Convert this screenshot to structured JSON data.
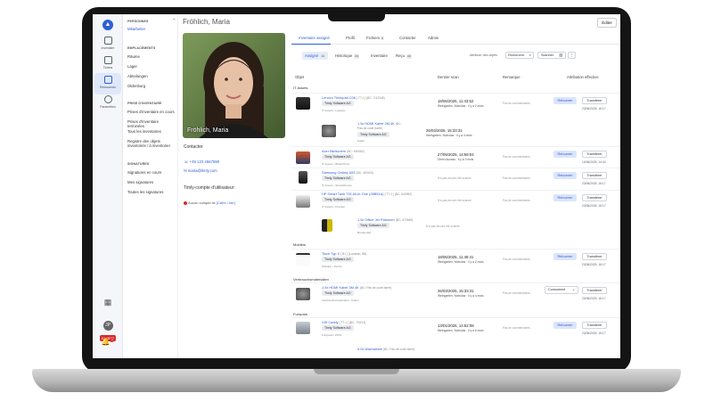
{
  "rail": {
    "items": [
      {
        "label": "Inventaire"
      },
      {
        "label": "Tickets"
      },
      {
        "label": "Ressources"
      },
      {
        "label": "Paramètres"
      }
    ],
    "avatar": "JP",
    "version": "61 9882"
  },
  "nav": {
    "sections": [
      {
        "title": "PERSONNES",
        "items": [
          "Mitarbeiter"
        ]
      },
      {
        "title": "EMPLACEMENTS",
        "items": [
          "Räume",
          "Lager",
          "Abteilungen",
          "Oldenburg"
        ]
      },
      {
        "title": "PRISE D'INVENTAIRE",
        "items": [
          "Prises d'inventaire en cours",
          "Prises d'inventaire terminées",
          "Tous les inventaires",
          "Registre des objets inventoriés / à inventorier"
        ]
      },
      {
        "title": "SIGNATURES",
        "items": [
          "Signatures en cours",
          "Mes signatures",
          "Toutes les signatures"
        ]
      }
    ]
  },
  "header": {
    "title": "Fröhlich, Maria",
    "edit_label": "Éditer"
  },
  "profile": {
    "name": "Fröhlich, Maria",
    "contact_heading": "Contacter",
    "phone": "+49 123 4567890",
    "email": "maria@timly.com",
    "account_heading": "Timly-compte d'utilisateur:",
    "account_status": "Aucun compte lié",
    "account_link": "[Créer / lier]"
  },
  "tabs": [
    {
      "label": "Inventaire assigné",
      "badge": ""
    },
    {
      "label": "Profil",
      "badge": ""
    },
    {
      "label": "Fichiers",
      "badge": "0"
    },
    {
      "label": "Contacter",
      "badge": ""
    },
    {
      "label": "Admin",
      "badge": ""
    }
  ],
  "subtabs": [
    {
      "label": "Assigné",
      "badge": "14"
    },
    {
      "label": "Historique",
      "badge": "24"
    },
    {
      "label": "Inventaire",
      "badge": ""
    },
    {
      "label": "Reçu",
      "badge": "44"
    }
  ],
  "toolbar": {
    "attribute_label": "Attribuer des objets",
    "search_placeholder": "Rechercher",
    "scan_label": "Scanner"
  },
  "columns": {
    "object": "Objet",
    "last_scan": "Dernier scan",
    "remark": "Remarque",
    "assignment": "Attribution effective"
  },
  "groups": [
    {
      "label": "IT Assets"
    },
    {
      "label": "Mobiliar"
    },
    {
      "label": "Verbrauchsmaterialien"
    },
    {
      "label": "Fuhrpark"
    }
  ],
  "rows": [
    {
      "name": "Lenovo Thinkpad C06",
      "tag": "[ T7.1 ] (BC: 7/12345)",
      "chip": "Timly Software AG",
      "cat": "IT Assets › Laptops",
      "date": "18/06/2025, 11:43:52",
      "by": "Weingarten, Nicholas · il y a 2 mois",
      "note": "Pas de commentaires",
      "ret": "Retourner",
      "tr": "Transférer",
      "adate": "23/06/2025, 16:17"
    },
    {
      "name": "1.5x HDMI Kabel 2M,4K",
      "tag": "(BC: Pas de code barre)",
      "chip": "Timly Software AG",
      "cat": "Kabel",
      "date": "26/03/2025, 15:33:31",
      "by": "Weingarten, Nicholas · il y a 4 mois",
      "note": "",
      "ret": "",
      "tr": "",
      "adate": ""
    },
    {
      "name": "Acer Bildschirm",
      "tag": "(BC: 490060)",
      "chip": "Timly Software AG",
      "cat": "IT Assets › Bildschirme",
      "date": "27/05/2025, 14:59:04",
      "by": "Direct Access · il y a 3 mois",
      "note": "Pas de commentaires",
      "ret": "Retourner",
      "tr": "Transférer",
      "adate": "10/06/2025, 14:40"
    },
    {
      "name": "Samsung Galaxy A53",
      "tag": "(BC: 490100)",
      "chip": "Timly Software AG",
      "cat": "IT Assets › Smartphones",
      "date": "",
      "by": "",
      "note": "N'a pas encore été scanné",
      "ret": "Retourner",
      "tr": "Transférer",
      "adate": "23/06/2025, 16:17"
    },
    {
      "name": "HP Smart Tank 725 All-In-One (28B51A)",
      "tag": "[ T7.1 ] (BC: 540952)",
      "chip": "Timly Software AG",
      "cat": "IT Assets › Drucker",
      "date": "",
      "by": "",
      "note": "N'a pas encore été scanné",
      "ret": "Retourner",
      "tr": "Transférer",
      "adate": "23/06/2025, 16:17"
    },
    {
      "name": "1.5x Office Jet Patronen",
      "tag": "(BC: 470680)",
      "chip": "Timly Software AG",
      "cat": "Bürobedarf",
      "date": "",
      "by": "",
      "note": "N'a pas encore été scanné",
      "ret": "",
      "tr": "",
      "adate": ""
    },
    {
      "name": "Tisch Typ X",
      "tag": "[ B1 ] (Location: B5)",
      "chip": "Timly Software AG",
      "cat": "Mobiliar › Tische",
      "date": "18/06/2025, 11:49:41",
      "by": "Weingarten, Nicholas · il y a 2 mois",
      "note": "Pas de commentaires",
      "ret": "Retourner",
      "tr": "Transférer",
      "adate": "23/06/2025, 16:17"
    },
    {
      "name": "1.5x HDMI Kabel 3M,4K",
      "tag": "(BC: Pas de code barre)",
      "chip": "Timly Software AG",
      "cat": "Verbrauchsmaterialien › Kabel",
      "date": "26/03/2025, 15:33:31",
      "by": "Weingarten, Nicholas · il y a 4 mois",
      "note": "Pas de commentaires",
      "ret": "",
      "tr": "Transférer",
      "adate": "23/06/2025, 16:17",
      "cons": "Consommé"
    },
    {
      "name": "VW Caddy",
      "tag": "[ T7.1 ] (BC: 7/N/12)",
      "chip": "Timly Software AG",
      "cat": "Fuhrpark › PKW",
      "date": "13/01/2025, 14:52:08",
      "by": "Weingarten, Nicholas · il y a 6 mois",
      "note": "Pas de commentaires",
      "ret": "Retourner",
      "tr": "Transférer",
      "adate": "23/06/2025, 16:17"
    },
    {
      "name": "5.0x Warnweste",
      "tag": "(BC: Pas de code barre)",
      "chip": "",
      "cat": "",
      "date": "",
      "by": "",
      "note": "",
      "ret": "",
      "tr": "",
      "adate": ""
    }
  ]
}
